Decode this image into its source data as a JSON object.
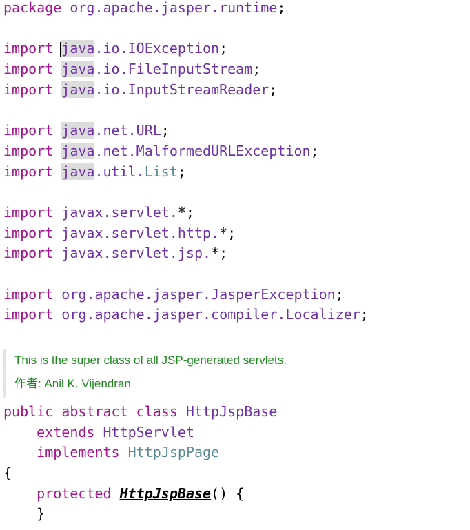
{
  "editor": {
    "top_lines": [
      [
        {
          "t": "package",
          "c": "kw"
        },
        {
          "t": " org.apache.jasper.runtime",
          "c": "pkg"
        },
        {
          "t": ";",
          "c": "plain"
        }
      ],
      [],
      [
        {
          "t": "import ",
          "c": "kw"
        },
        {
          "t": "",
          "c": "caret"
        },
        {
          "t": "java",
          "c": "pkg hl"
        },
        {
          "t": ".io.IOException",
          "c": "pkg"
        },
        {
          "t": ";",
          "c": "plain"
        }
      ],
      [
        {
          "t": "import ",
          "c": "kw"
        },
        {
          "t": "java",
          "c": "pkg hl"
        },
        {
          "t": ".io.FileInputStream",
          "c": "pkg"
        },
        {
          "t": ";",
          "c": "plain"
        }
      ],
      [
        {
          "t": "import ",
          "c": "kw"
        },
        {
          "t": "java",
          "c": "pkg hl"
        },
        {
          "t": ".io.InputStreamReader",
          "c": "pkg"
        },
        {
          "t": ";",
          "c": "plain"
        }
      ],
      [],
      [
        {
          "t": "import ",
          "c": "kw"
        },
        {
          "t": "java",
          "c": "pkg hl"
        },
        {
          "t": ".net.URL",
          "c": "pkg"
        },
        {
          "t": ";",
          "c": "plain"
        }
      ],
      [
        {
          "t": "import ",
          "c": "kw"
        },
        {
          "t": "java",
          "c": "pkg hl"
        },
        {
          "t": ".net.MalformedURLException",
          "c": "pkg"
        },
        {
          "t": ";",
          "c": "plain"
        }
      ],
      [
        {
          "t": "import ",
          "c": "kw"
        },
        {
          "t": "java",
          "c": "pkg hl"
        },
        {
          "t": ".util.",
          "c": "pkg"
        },
        {
          "t": "List",
          "c": "type"
        },
        {
          "t": ";",
          "c": "plain"
        }
      ],
      [],
      [
        {
          "t": "import ",
          "c": "kw"
        },
        {
          "t": "javax.servlet.",
          "c": "pkg"
        },
        {
          "t": "*;",
          "c": "plain"
        }
      ],
      [
        {
          "t": "import ",
          "c": "kw"
        },
        {
          "t": "javax.servlet.http.",
          "c": "pkg"
        },
        {
          "t": "*;",
          "c": "plain"
        }
      ],
      [
        {
          "t": "import ",
          "c": "kw"
        },
        {
          "t": "javax.servlet.jsp.",
          "c": "pkg"
        },
        {
          "t": "*;",
          "c": "plain"
        }
      ],
      [],
      [
        {
          "t": "import ",
          "c": "kw"
        },
        {
          "t": "org.apache.jasper.JasperException",
          "c": "pkg"
        },
        {
          "t": ";",
          "c": "plain"
        }
      ],
      [
        {
          "t": "import ",
          "c": "kw"
        },
        {
          "t": "org.apache.jasper.compiler.Localizer",
          "c": "pkg"
        },
        {
          "t": ";",
          "c": "plain"
        }
      ]
    ],
    "javadoc": {
      "description": "This is the super class of all JSP-generated servlets.",
      "author": "作者: Anil K. Vijendran"
    },
    "bottom_lines": [
      [
        {
          "t": "public abstract class ",
          "c": "kw"
        },
        {
          "t": "HttpJspBase",
          "c": "pkg"
        }
      ],
      [
        {
          "t": "    extends ",
          "c": "kw"
        },
        {
          "t": "HttpServlet",
          "c": "pkg"
        }
      ],
      [
        {
          "t": "    implements ",
          "c": "kw"
        },
        {
          "t": "HttpJspPage",
          "c": "type"
        }
      ],
      [
        {
          "t": "{",
          "c": "plain"
        }
      ],
      [
        {
          "t": "    protected ",
          "c": "kw"
        },
        {
          "t": "HttpJspBase",
          "c": "decl"
        },
        {
          "t": "() {",
          "c": "plain"
        }
      ],
      [
        {
          "t": "    }",
          "c": "plain"
        }
      ]
    ]
  }
}
